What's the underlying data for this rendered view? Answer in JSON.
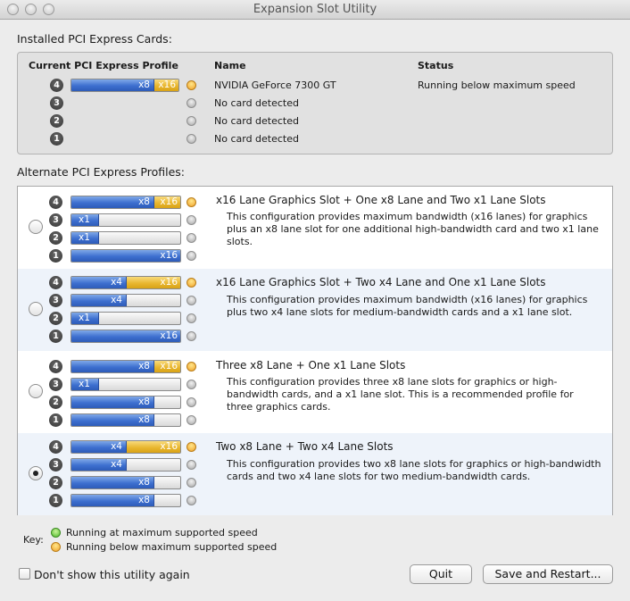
{
  "window": {
    "title": "Expansion Slot Utility"
  },
  "installed": {
    "section_label": "Installed PCI Express Cards:",
    "headers": {
      "profile": "Current PCI Express Profile",
      "name": "Name",
      "status": "Status"
    },
    "slots": [
      {
        "num": "4",
        "blue_label": "x8",
        "gold_label": "x16",
        "status_dot": "orange",
        "name": "NVIDIA GeForce 7300 GT",
        "status": "Running below maximum speed"
      },
      {
        "num": "3",
        "status_dot": "gray",
        "name": "No card detected",
        "status": ""
      },
      {
        "num": "2",
        "status_dot": "gray",
        "name": "No card detected",
        "status": ""
      },
      {
        "num": "1",
        "status_dot": "gray",
        "name": "No card detected",
        "status": ""
      }
    ]
  },
  "alternate": {
    "section_label": "Alternate PCI Express Profiles:",
    "profiles": [
      {
        "title": "x16 Lane Graphics Slot + One x8 Lane and Two x1 Lane Slots",
        "description": "This configuration provides maximum bandwidth (x16 lanes) for graphics plus an x8 lane slot for one additional high-bandwidth card and two x1 lane slots.",
        "selected": false,
        "slots": [
          {
            "num": "4",
            "labels": [
              "x8",
              "x16"
            ],
            "dot": "orange"
          },
          {
            "num": "3",
            "labels": [
              "x1"
            ],
            "dot": "gray"
          },
          {
            "num": "2",
            "labels": [
              "x1"
            ],
            "dot": "gray"
          },
          {
            "num": "1",
            "labels": [
              "x16"
            ],
            "dot": "gray"
          }
        ]
      },
      {
        "title": "x16 Lane Graphics Slot + Two x4 Lane and One x1 Lane Slots",
        "description": "This configuration provides maximum bandwidth (x16 lanes) for graphics plus two x4 lane slots for medium-bandwidth cards and a x1 lane slot.",
        "selected": false,
        "slots": [
          {
            "num": "4",
            "labels": [
              "x4",
              "x16"
            ],
            "dot": "orange"
          },
          {
            "num": "3",
            "labels": [
              "x4"
            ],
            "dot": "gray"
          },
          {
            "num": "2",
            "labels": [
              "x1"
            ],
            "dot": "gray"
          },
          {
            "num": "1",
            "labels": [
              "x16"
            ],
            "dot": "gray"
          }
        ]
      },
      {
        "title": "Three x8 Lane + One x1 Lane Slots",
        "description": "This configuration provides three x8 lane slots for graphics or high-bandwidth cards, and a x1 lane slot.  This is a recommended profile for three graphics cards.",
        "selected": false,
        "slots": [
          {
            "num": "4",
            "labels": [
              "x8",
              "x16"
            ],
            "dot": "orange"
          },
          {
            "num": "3",
            "labels": [
              "x1"
            ],
            "dot": "gray"
          },
          {
            "num": "2",
            "labels": [
              "x8"
            ],
            "dot": "gray"
          },
          {
            "num": "1",
            "labels": [
              "x8"
            ],
            "dot": "gray"
          }
        ]
      },
      {
        "title": "Two x8 Lane + Two x4 Lane Slots",
        "description": "This configuration provides two x8 lane slots for graphics or high-bandwidth cards and two x4 lane slots for two medium-bandwidth cards.",
        "selected": true,
        "slots": [
          {
            "num": "4",
            "labels": [
              "x4",
              "x16"
            ],
            "dot": "orange"
          },
          {
            "num": "3",
            "labels": [
              "x4"
            ],
            "dot": "gray"
          },
          {
            "num": "2",
            "labels": [
              "x8"
            ],
            "dot": "gray"
          },
          {
            "num": "1",
            "labels": [
              "x8"
            ],
            "dot": "gray"
          }
        ]
      }
    ]
  },
  "key": {
    "label": "Key:",
    "items": [
      {
        "color": "green",
        "text": "Running at maximum supported speed"
      },
      {
        "color": "orange",
        "text": "Running below maximum supported speed"
      }
    ]
  },
  "footer": {
    "checkbox_label": "Don't show this utility again",
    "checkbox_checked": false,
    "quit_label": "Quit",
    "save_label": "Save and Restart..."
  },
  "colors": {
    "blue": "#3d6fcf",
    "gold": "#e9b730",
    "status_orange": "#f1a22a",
    "status_green": "#4fbb2b"
  }
}
